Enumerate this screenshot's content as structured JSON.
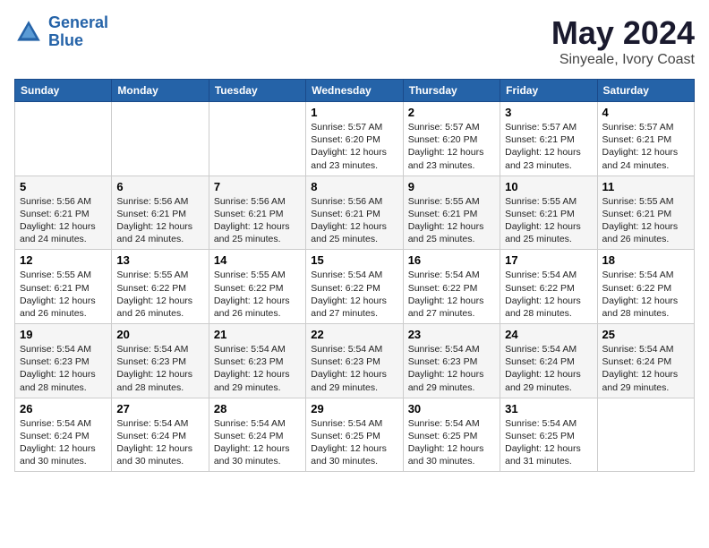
{
  "header": {
    "logo_line1": "General",
    "logo_line2": "Blue",
    "month": "May 2024",
    "location": "Sinyeale, Ivory Coast"
  },
  "weekdays": [
    "Sunday",
    "Monday",
    "Tuesday",
    "Wednesday",
    "Thursday",
    "Friday",
    "Saturday"
  ],
  "weeks": [
    [
      {
        "day": "",
        "sunrise": "",
        "sunset": "",
        "daylight": ""
      },
      {
        "day": "",
        "sunrise": "",
        "sunset": "",
        "daylight": ""
      },
      {
        "day": "",
        "sunrise": "",
        "sunset": "",
        "daylight": ""
      },
      {
        "day": "1",
        "sunrise": "Sunrise: 5:57 AM",
        "sunset": "Sunset: 6:20 PM",
        "daylight": "Daylight: 12 hours and 23 minutes."
      },
      {
        "day": "2",
        "sunrise": "Sunrise: 5:57 AM",
        "sunset": "Sunset: 6:20 PM",
        "daylight": "Daylight: 12 hours and 23 minutes."
      },
      {
        "day": "3",
        "sunrise": "Sunrise: 5:57 AM",
        "sunset": "Sunset: 6:21 PM",
        "daylight": "Daylight: 12 hours and 23 minutes."
      },
      {
        "day": "4",
        "sunrise": "Sunrise: 5:57 AM",
        "sunset": "Sunset: 6:21 PM",
        "daylight": "Daylight: 12 hours and 24 minutes."
      }
    ],
    [
      {
        "day": "5",
        "sunrise": "Sunrise: 5:56 AM",
        "sunset": "Sunset: 6:21 PM",
        "daylight": "Daylight: 12 hours and 24 minutes."
      },
      {
        "day": "6",
        "sunrise": "Sunrise: 5:56 AM",
        "sunset": "Sunset: 6:21 PM",
        "daylight": "Daylight: 12 hours and 24 minutes."
      },
      {
        "day": "7",
        "sunrise": "Sunrise: 5:56 AM",
        "sunset": "Sunset: 6:21 PM",
        "daylight": "Daylight: 12 hours and 25 minutes."
      },
      {
        "day": "8",
        "sunrise": "Sunrise: 5:56 AM",
        "sunset": "Sunset: 6:21 PM",
        "daylight": "Daylight: 12 hours and 25 minutes."
      },
      {
        "day": "9",
        "sunrise": "Sunrise: 5:55 AM",
        "sunset": "Sunset: 6:21 PM",
        "daylight": "Daylight: 12 hours and 25 minutes."
      },
      {
        "day": "10",
        "sunrise": "Sunrise: 5:55 AM",
        "sunset": "Sunset: 6:21 PM",
        "daylight": "Daylight: 12 hours and 25 minutes."
      },
      {
        "day": "11",
        "sunrise": "Sunrise: 5:55 AM",
        "sunset": "Sunset: 6:21 PM",
        "daylight": "Daylight: 12 hours and 26 minutes."
      }
    ],
    [
      {
        "day": "12",
        "sunrise": "Sunrise: 5:55 AM",
        "sunset": "Sunset: 6:21 PM",
        "daylight": "Daylight: 12 hours and 26 minutes."
      },
      {
        "day": "13",
        "sunrise": "Sunrise: 5:55 AM",
        "sunset": "Sunset: 6:22 PM",
        "daylight": "Daylight: 12 hours and 26 minutes."
      },
      {
        "day": "14",
        "sunrise": "Sunrise: 5:55 AM",
        "sunset": "Sunset: 6:22 PM",
        "daylight": "Daylight: 12 hours and 26 minutes."
      },
      {
        "day": "15",
        "sunrise": "Sunrise: 5:54 AM",
        "sunset": "Sunset: 6:22 PM",
        "daylight": "Daylight: 12 hours and 27 minutes."
      },
      {
        "day": "16",
        "sunrise": "Sunrise: 5:54 AM",
        "sunset": "Sunset: 6:22 PM",
        "daylight": "Daylight: 12 hours and 27 minutes."
      },
      {
        "day": "17",
        "sunrise": "Sunrise: 5:54 AM",
        "sunset": "Sunset: 6:22 PM",
        "daylight": "Daylight: 12 hours and 28 minutes."
      },
      {
        "day": "18",
        "sunrise": "Sunrise: 5:54 AM",
        "sunset": "Sunset: 6:22 PM",
        "daylight": "Daylight: 12 hours and 28 minutes."
      }
    ],
    [
      {
        "day": "19",
        "sunrise": "Sunrise: 5:54 AM",
        "sunset": "Sunset: 6:23 PM",
        "daylight": "Daylight: 12 hours and 28 minutes."
      },
      {
        "day": "20",
        "sunrise": "Sunrise: 5:54 AM",
        "sunset": "Sunset: 6:23 PM",
        "daylight": "Daylight: 12 hours and 28 minutes."
      },
      {
        "day": "21",
        "sunrise": "Sunrise: 5:54 AM",
        "sunset": "Sunset: 6:23 PM",
        "daylight": "Daylight: 12 hours and 29 minutes."
      },
      {
        "day": "22",
        "sunrise": "Sunrise: 5:54 AM",
        "sunset": "Sunset: 6:23 PM",
        "daylight": "Daylight: 12 hours and 29 minutes."
      },
      {
        "day": "23",
        "sunrise": "Sunrise: 5:54 AM",
        "sunset": "Sunset: 6:23 PM",
        "daylight": "Daylight: 12 hours and 29 minutes."
      },
      {
        "day": "24",
        "sunrise": "Sunrise: 5:54 AM",
        "sunset": "Sunset: 6:24 PM",
        "daylight": "Daylight: 12 hours and 29 minutes."
      },
      {
        "day": "25",
        "sunrise": "Sunrise: 5:54 AM",
        "sunset": "Sunset: 6:24 PM",
        "daylight": "Daylight: 12 hours and 29 minutes."
      }
    ],
    [
      {
        "day": "26",
        "sunrise": "Sunrise: 5:54 AM",
        "sunset": "Sunset: 6:24 PM",
        "daylight": "Daylight: 12 hours and 30 minutes."
      },
      {
        "day": "27",
        "sunrise": "Sunrise: 5:54 AM",
        "sunset": "Sunset: 6:24 PM",
        "daylight": "Daylight: 12 hours and 30 minutes."
      },
      {
        "day": "28",
        "sunrise": "Sunrise: 5:54 AM",
        "sunset": "Sunset: 6:24 PM",
        "daylight": "Daylight: 12 hours and 30 minutes."
      },
      {
        "day": "29",
        "sunrise": "Sunrise: 5:54 AM",
        "sunset": "Sunset: 6:25 PM",
        "daylight": "Daylight: 12 hours and 30 minutes."
      },
      {
        "day": "30",
        "sunrise": "Sunrise: 5:54 AM",
        "sunset": "Sunset: 6:25 PM",
        "daylight": "Daylight: 12 hours and 30 minutes."
      },
      {
        "day": "31",
        "sunrise": "Sunrise: 5:54 AM",
        "sunset": "Sunset: 6:25 PM",
        "daylight": "Daylight: 12 hours and 31 minutes."
      },
      {
        "day": "",
        "sunrise": "",
        "sunset": "",
        "daylight": ""
      }
    ]
  ]
}
